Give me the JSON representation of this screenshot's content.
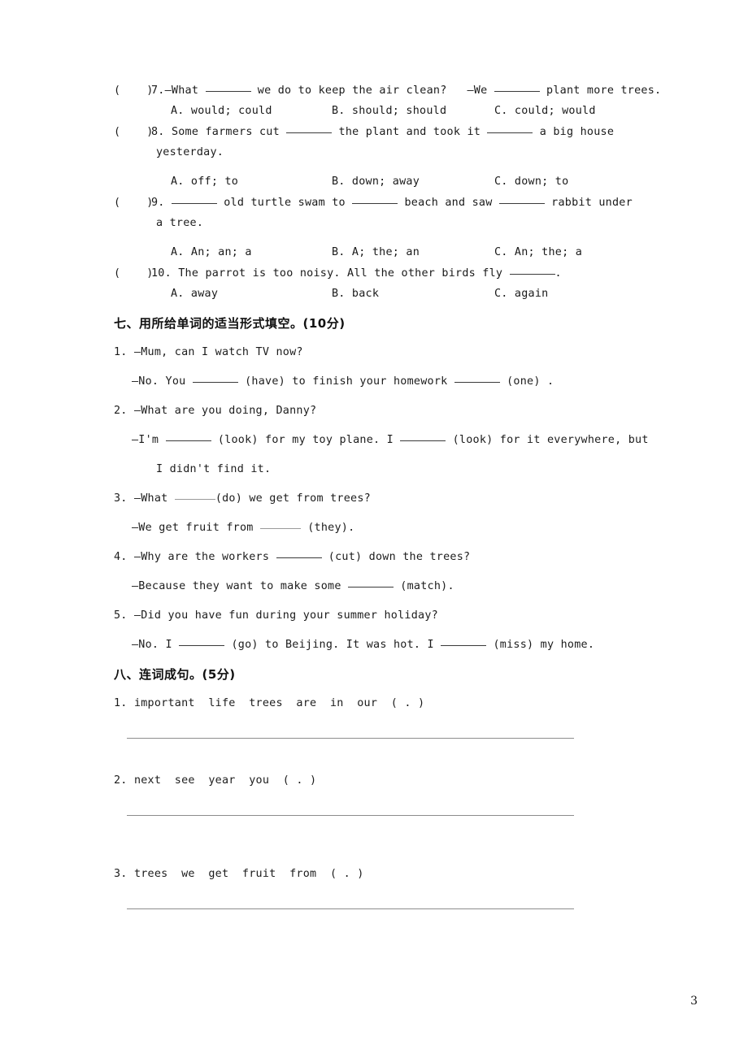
{
  "page": {
    "number": "3"
  },
  "multiple_choice": {
    "questions": [
      {
        "paren": "(    )",
        "number": "7.",
        "text_before": "—What ",
        "text_mid": " we do to keep the air clean?   —We ",
        "text_after": " plant more trees.",
        "options": {
          "a": "A. would; could",
          "b": "B. should; should",
          "c": "C. could; would"
        }
      },
      {
        "paren": "(    )",
        "number": "8.",
        "text_before": "Some farmers cut ",
        "text_mid": " the plant and took it ",
        "text_after": " a big house",
        "continuation": "yesterday.",
        "options": {
          "a": "A. off; to",
          "b": "B. down; away",
          "c": "C. down; to"
        }
      },
      {
        "paren": "(    )",
        "number": "9.",
        "text_before": "",
        "text_mid": " old turtle swam to ",
        "text_after2": " beach and saw ",
        "text_after": " rabbit under",
        "continuation": "a tree.",
        "options": {
          "a": "A. An; an; a",
          "b": "B. A; the; an",
          "c": "C. An; the; a"
        }
      },
      {
        "paren": "(    )",
        "number": "10.",
        "text_before": "The parrot is too noisy. All the other birds fly ",
        "text_after": ".",
        "options": {
          "a": "A. away",
          "b": "B. back",
          "c": "C. again"
        }
      }
    ]
  },
  "section_seven": {
    "heading": "七、用所给单词的适当形式填空。(10分)",
    "items": [
      {
        "num": "1.",
        "line1": "—Mum, can I watch TV now?",
        "line2_a": "—No. You ",
        "line2_b": " (have) to finish your homework ",
        "line2_c": " (one) ."
      },
      {
        "num": "2.",
        "line1": "—What are you doing, Danny?",
        "line2_a": "—I'm ",
        "line2_b": " (look) for my toy plane. I ",
        "line2_c": " (look) for it everywhere, but",
        "line3": "I didn't find it."
      },
      {
        "num": "3.",
        "line1_a": "—What ",
        "line1_b": "(do) we get from trees?",
        "line2_a": "—We get fruit from ",
        "line2_b": " (they)."
      },
      {
        "num": "4.",
        "line1_a": "—Why are the workers ",
        "line1_b": " (cut) down the trees?",
        "line2_a": "—Because they want to make some ",
        "line2_b": " (match)."
      },
      {
        "num": "5.",
        "line1": "—Did you have fun during your summer holiday?",
        "line2_a": "—No. I ",
        "line2_b": " (go) to Beijing. It was hot. I ",
        "line2_c": " (miss) my home."
      }
    ]
  },
  "section_eight": {
    "heading": "八、连词成句。(5分)",
    "items": [
      {
        "num": "1.",
        "words": "important  life  trees  are  in  our  ( . )"
      },
      {
        "num": "2.",
        "words": "next  see  year  you  ( . )"
      },
      {
        "num": "3.",
        "words": "trees  we  get  fruit  from  ( . )"
      }
    ]
  }
}
